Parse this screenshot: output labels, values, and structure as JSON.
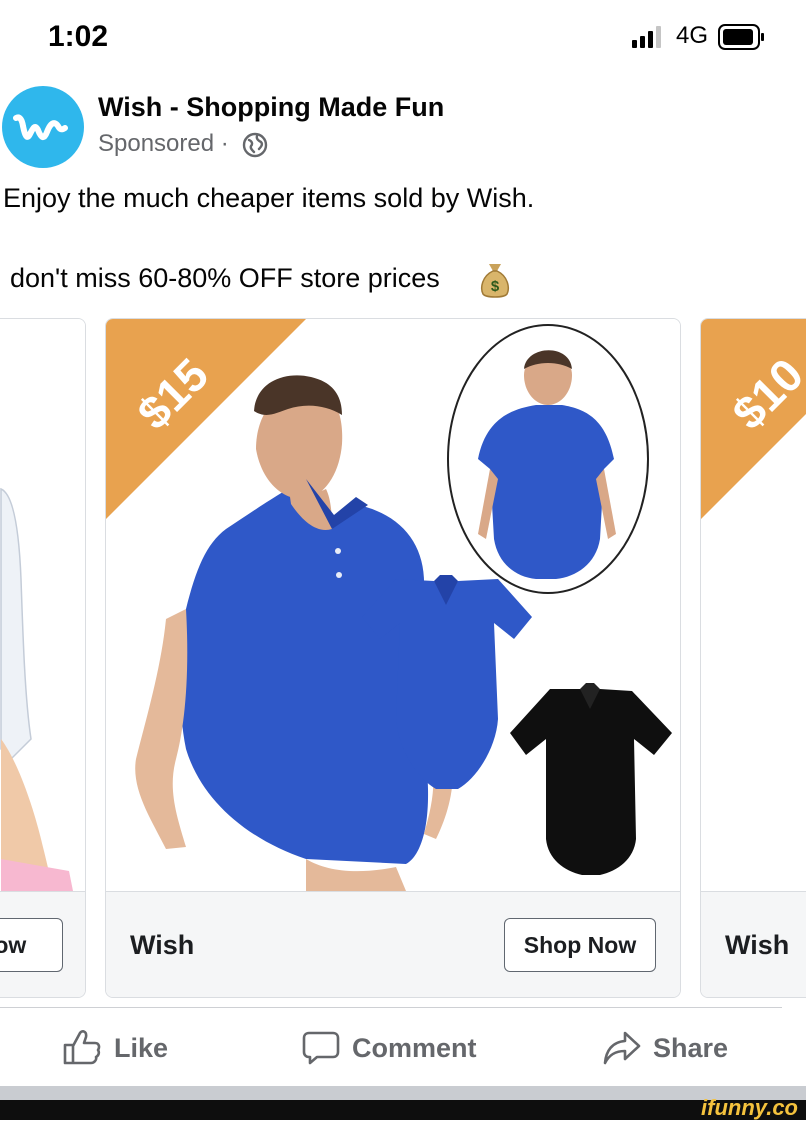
{
  "status_bar": {
    "time": "1:02",
    "network": "4G"
  },
  "post": {
    "page_name": "Wish - Shopping Made Fun",
    "sponsored_label": "Sponsored ·",
    "caption_line1": "Enjoy the much cheaper items sold by Wish.",
    "caption_line2": "don't miss 60-80% OFF store prices",
    "avatar_letter": "w"
  },
  "carousel": {
    "left_card": {
      "button_label": "Now"
    },
    "main_card": {
      "price_tag": "$15",
      "brand": "Wish",
      "button_label": "Shop Now"
    },
    "right_card": {
      "price_tag": "$10",
      "brand": "Wish"
    }
  },
  "actions": {
    "like": "Like",
    "comment": "Comment",
    "share": "Share"
  },
  "watermark": "ifunny.co",
  "colors": {
    "accent": "#2fb7ec",
    "price_tag": "#e8a24f",
    "shirt_blue": "#2f58c8",
    "muted_text": "#65676b"
  }
}
